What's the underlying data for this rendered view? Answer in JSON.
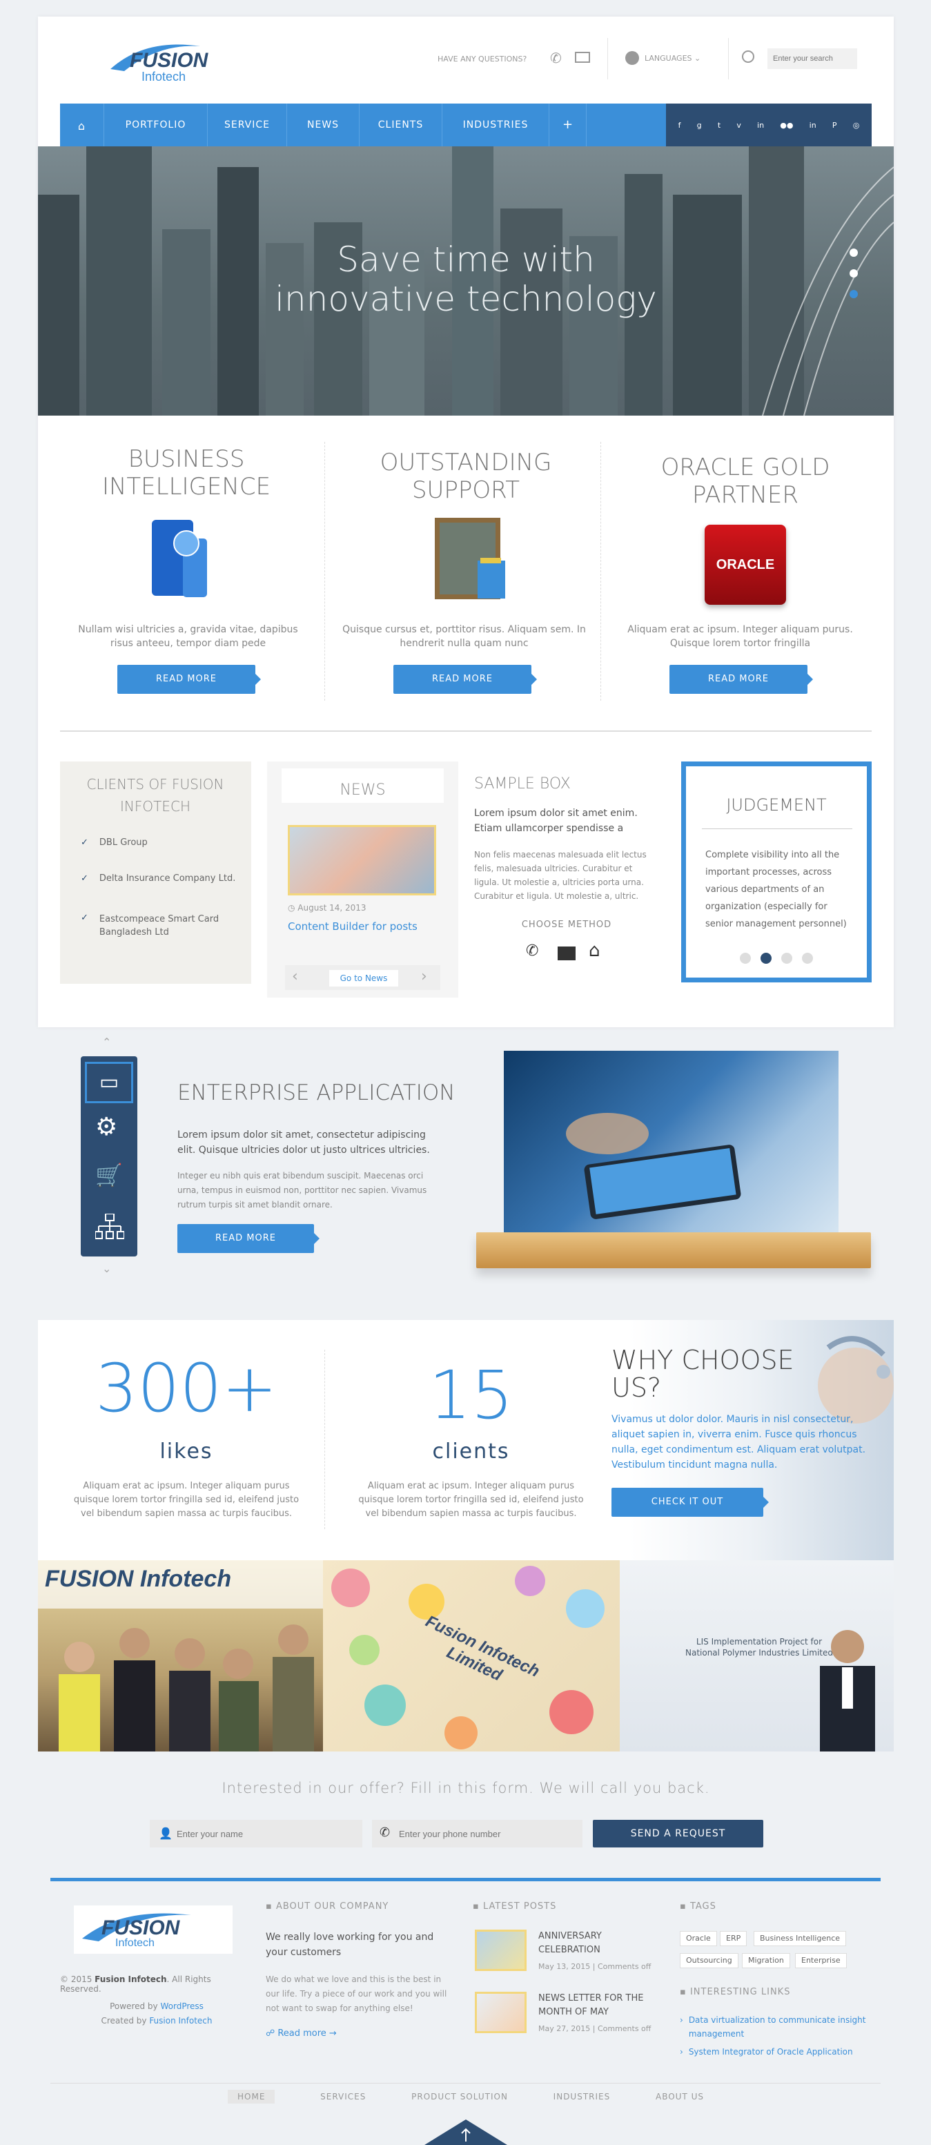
{
  "header": {
    "logo_top": "FUSION",
    "logo_bottom": "Infotech",
    "questions": "HAVE ANY QUESTIONS?",
    "languages": "LANGUAGES",
    "search_placeholder": "Enter your search"
  },
  "nav": {
    "items": [
      "PORTFOLIO",
      "SERVICE",
      "NEWS",
      "CLIENTS",
      "INDUSTRIES"
    ],
    "plus": "+"
  },
  "social": [
    "f",
    "g",
    "t",
    "v",
    "in",
    "●●",
    "in",
    "P",
    "◎"
  ],
  "hero": {
    "line1": "Save time with",
    "line2": "innovative technology"
  },
  "features": [
    {
      "title": "BUSINESS INTELLIGENCE",
      "text": "Nullam wisi ultricies a, gravida vitae, dapibus risus anteeu, tempor diam pede",
      "button": "READ MORE"
    },
    {
      "title": "OUTSTANDING SUPPORT",
      "text": "Quisque cursus et, porttitor risus. Aliquam sem. In hendrerit nulla quam nunc",
      "button": "READ MORE"
    },
    {
      "title": "ORACLE GOLD PARTNER",
      "text": "Aliquam erat ac ipsum. Integer aliquam purus. Quisque lorem tortor fringilla",
      "button": "READ MORE"
    }
  ],
  "oracle_label": "ORACLE",
  "clients_box": {
    "title": "CLIENTS OF FUSION INFOTECH",
    "items": [
      "DBL Group",
      "Delta Insurance Company Ltd.",
      "Eastcompeace Smart Card Bangladesh Ltd"
    ]
  },
  "news_box": {
    "title": "NEWS",
    "date": "August 14, 2013",
    "post": "Content Builder for posts",
    "link": "Go to News"
  },
  "sample_box": {
    "title": "SAMPLE BOX",
    "lead": "Lorem ipsum dolor sit amet enim. Etiam ullamcorper spendisse a",
    "body": "Non felis maecenas malesuada elit lectus felis, malesuada ultricies. Curabitur et ligula. Ut molestie a, ultricies porta urna. Curabitur et ligula. Ut molestie a, ultric.",
    "contact": "CHOOSE METHOD"
  },
  "judgement": {
    "title": "JUDGEMENT",
    "text": "Complete visibility into all the important processes, across various departments of an organization (especially for senior management personnel)"
  },
  "enterprise": {
    "title": "ENTERPRISE APPLICATION",
    "lead": "Lorem ipsum dolor sit amet, consectetur adipiscing elit. Quisque ultricies dolor ut justo ultrices ultricies.",
    "body": "Integer eu nibh quis erat bibendum suscipit. Maecenas orci urna, tempus in euismod non, porttitor nec sapien. Vivamus rutrum turpis sit amet blandit ornare.",
    "button": "READ MORE"
  },
  "stats": [
    {
      "number": "300+",
      "label": "likes",
      "text": "Aliquam erat ac ipsum. Integer aliquam purus quisque lorem tortor fringilla sed id, eleifend justo vel bibendum sapien massa ac turpis faucibus."
    },
    {
      "number": "15",
      "label": "clients",
      "text": "Aliquam erat ac ipsum. Integer aliquam purus quisque lorem tortor fringilla sed id, eleifend justo vel bibendum sapien massa ac turpis faucibus."
    }
  ],
  "why": {
    "title": "WHY CHOOSE US?",
    "text": "Vivamus ut dolor dolor. Mauris in nisl consectetur, aliquet sapien in, viverra enim. Fusce quis rhoncus nulla, eget condimentum est. Aliquam erat volutpat. Vestibulum tincidunt magna nulla.",
    "button": "CHECK IT OUT"
  },
  "gallery": {
    "banner1": "FUSION Infotech",
    "banner2": "Fusion Infotech Limited",
    "banner3": "LIS Implementation Project for National Polymer Industries Limited"
  },
  "form": {
    "title": "Interested in our offer? Fill in this form. We will call you back.",
    "name_placeholder": "Enter your name",
    "phone_placeholder": "Enter your phone number",
    "button": "SEND A REQUEST"
  },
  "footer": {
    "copyright_pre": "© 2015 ",
    "copyright_name": "Fusion Infotech",
    "copyright_post": ". All Rights Reserved.",
    "powered_pre": "Powered by ",
    "powered_link": "WordPress",
    "created_pre": "Created by ",
    "created_link": "Fusion Infotech",
    "about_title": "ABOUT OUR COMPANY",
    "about_lead": "We really love working for you and your customers",
    "about_text": "We do what we love and this is the best in our life. Try a piece of our work and you will not want to swap for anything else!",
    "read_more": "Read more →",
    "posts_title": "LATEST POSTS",
    "posts": [
      {
        "title": "ANNIVERSARY CELEBRATION",
        "date": "May 13, 2015",
        "comments": "Comments off"
      },
      {
        "title": "NEWS LETTER FOR THE MONTH OF MAY",
        "date": "May 27, 2015",
        "comments": "Comments off"
      }
    ],
    "tags_title": "TAGS",
    "tags": [
      "Oracle",
      "ERP",
      "Business Intelligence",
      "Outsourcing",
      "Migration",
      "Enterprise"
    ],
    "links_title": "INTERESTING LINKS",
    "links": [
      "Data virtualization to communicate insight management",
      "System Integrator of Oracle Application"
    ],
    "nav": [
      "HOME",
      "SERVICES",
      "PRODUCT SOLUTION",
      "INDUSTRIES",
      "ABOUT US"
    ]
  },
  "colors": {
    "accent": "#3b8fd9",
    "dark": "#2d4d72",
    "nav": "#3b8fd9"
  }
}
